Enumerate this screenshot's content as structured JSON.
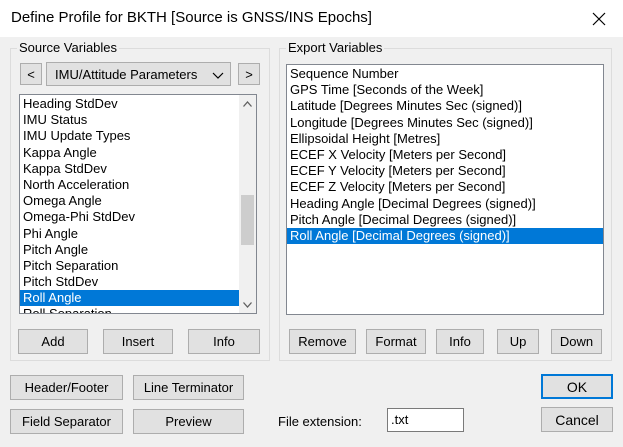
{
  "window": {
    "title": "Define Profile for BKTH [Source is GNSS/INS Epochs]"
  },
  "source": {
    "group_label": "Source Variables",
    "prev_label": "<",
    "next_label": ">",
    "category": "IMU/Attitude Parameters",
    "items": [
      "Heading StdDev",
      "IMU Status",
      "IMU Update Types",
      "Kappa Angle",
      "Kappa StdDev",
      "North Acceleration",
      "Omega Angle",
      "Omega-Phi StdDev",
      "Phi Angle",
      "Pitch Angle",
      "Pitch Separation",
      "Pitch StdDev",
      "Roll Angle",
      "Roll Separation"
    ],
    "selected_index": 12,
    "add_label": "Add",
    "insert_label": "Insert",
    "info_label": "Info"
  },
  "export": {
    "group_label": "Export Variables",
    "items": [
      "Sequence Number",
      "GPS Time [Seconds of the Week]",
      "Latitude [Degrees Minutes Sec (signed)]",
      "Longitude [Degrees Minutes Sec (signed)]",
      "Ellipsoidal Height [Metres]",
      "ECEF X Velocity [Meters per Second]",
      "ECEF Y Velocity [Meters per Second]",
      "ECEF Z Velocity [Meters per Second]",
      "Heading Angle [Decimal Degrees (signed)]",
      "Pitch Angle [Decimal Degrees (signed)]",
      "Roll Angle [Decimal Degrees (signed)]"
    ],
    "selected_index": 10,
    "remove_label": "Remove",
    "format_label": "Format",
    "info_label": "Info",
    "up_label": "Up",
    "down_label": "Down"
  },
  "bottom": {
    "header_footer_label": "Header/Footer",
    "line_terminator_label": "Line Terminator",
    "field_separator_label": "Field Separator",
    "preview_label": "Preview",
    "file_extension_label": "File extension:",
    "file_extension_value": ".txt",
    "ok_label": "OK",
    "cancel_label": "Cancel"
  },
  "colors": {
    "selection": "#0078d7",
    "default_button_border": "#0078d7"
  },
  "icons": {
    "close": "close-icon",
    "combo_arrow": "chevron-down-icon",
    "scroll_up": "chevron-up-icon",
    "scroll_down": "chevron-down-icon"
  }
}
